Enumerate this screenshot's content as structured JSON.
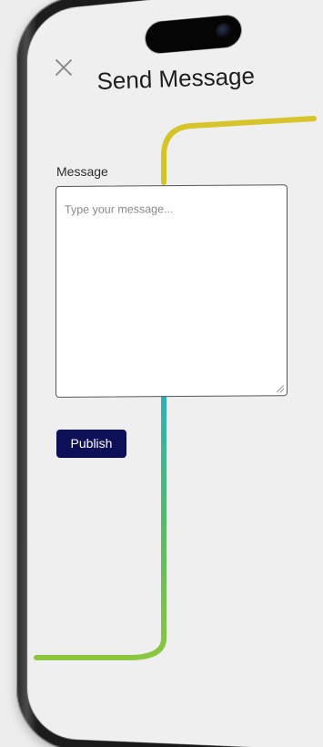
{
  "dialog": {
    "title": "Send Message",
    "close_icon": "close-icon"
  },
  "form": {
    "message_label": "Message",
    "message_value": "",
    "message_placeholder": "Type your message..."
  },
  "actions": {
    "publish_label": "Publish"
  },
  "colors": {
    "primary_button": "#0d0f57",
    "route_start": "#d1c42a",
    "route_mid": "#2fb0b4",
    "route_end": "#8cc63f"
  }
}
